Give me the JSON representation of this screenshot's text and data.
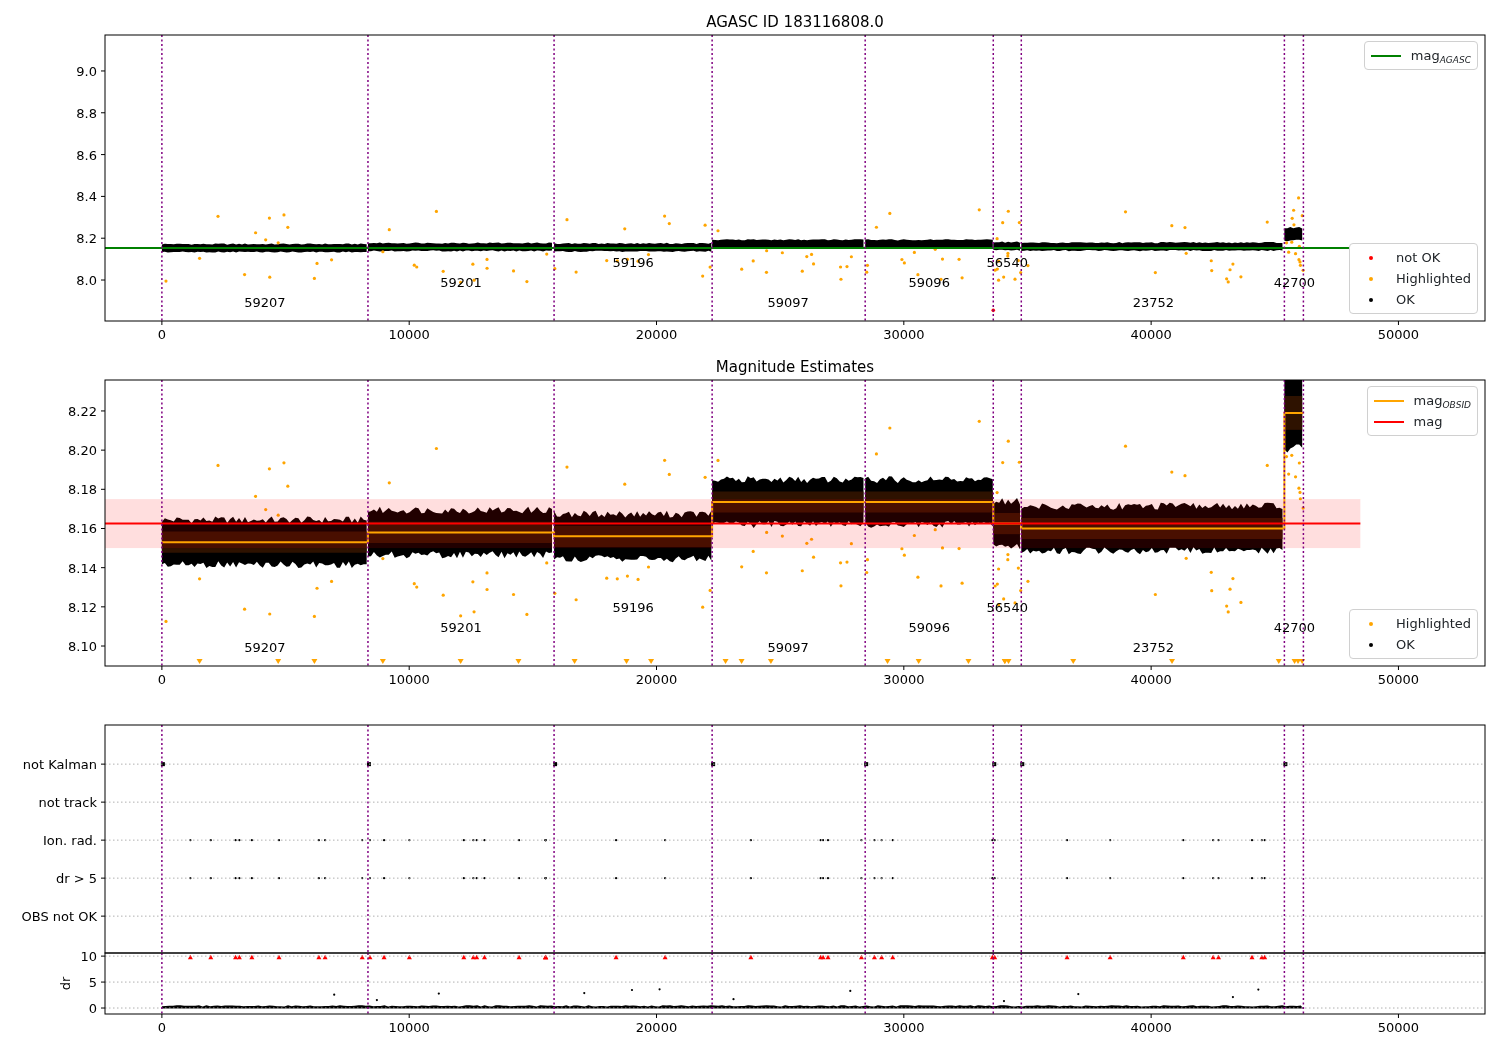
{
  "figure": {
    "charts": [
      {
        "chart_data": {
          "type": "line",
          "title": "AGASC ID 183116808.0",
          "xlim": [
            -2300,
            53500
          ],
          "ylim": [
            7.804,
            9.172
          ],
          "xticks": [
            0,
            10000,
            20000,
            30000,
            40000,
            50000
          ],
          "yticks": [
            {
              "value": 8.0,
              "label": "8.0"
            },
            {
              "value": 8.2,
              "label": "8.2"
            },
            {
              "value": 8.4,
              "label": "8.4"
            },
            {
              "value": 8.6,
              "label": "8.6"
            },
            {
              "value": 8.8,
              "label": "8.8"
            },
            {
              "value": 9.0,
              "label": "9.0"
            }
          ],
          "series": [
            {
              "name": "mag$_{AGASC}$",
              "color": "#008000",
              "x": [
                -2300,
                48000
              ],
              "values": [
                8.153,
                8.153
              ]
            }
          ],
          "ref_lines": [
            {
              "axis": "x",
              "value": 0
            },
            {
              "axis": "x",
              "value": 8333
            },
            {
              "axis": "x",
              "value": 15858
            },
            {
              "axis": "x",
              "value": 22249
            },
            {
              "axis": "x",
              "value": 28438
            },
            {
              "axis": "x",
              "value": 33617
            },
            {
              "axis": "x",
              "value": 34750
            },
            {
              "axis": "x",
              "value": 45388
            },
            {
              "axis": "x",
              "value": 46157
            }
          ],
          "annotations": [
            "59207",
            "59201",
            "59196",
            "59097",
            "59096",
            "56540",
            "23752",
            "42700"
          ]
        },
        "marker_legend": [
          {
            "label": "not OK",
            "color": "#ff0000"
          },
          {
            "label": "Highlighted",
            "color": "#ffa500"
          },
          {
            "label": "OK",
            "color": "#000000"
          }
        ]
      },
      {
        "chart_data": {
          "type": "line",
          "title": "Magnitude Estimates",
          "xlim": [
            -2300,
            53500
          ],
          "ylim": [
            8.0898,
            8.2358
          ],
          "xticks": [
            0,
            10000,
            20000,
            30000,
            40000,
            50000
          ],
          "yticks": [
            {
              "value": 8.1,
              "label": "8.10"
            },
            {
              "value": 8.12,
              "label": "8.12"
            },
            {
              "value": 8.14,
              "label": "8.14"
            },
            {
              "value": 8.16,
              "label": "8.16"
            },
            {
              "value": 8.18,
              "label": "8.18"
            },
            {
              "value": 8.2,
              "label": "8.20"
            },
            {
              "value": 8.22,
              "label": "8.22"
            }
          ],
          "series": [
            {
              "name": "mag$_{OBSID}$",
              "color": "#ffa500",
              "x": [
                0,
                8333,
                8333,
                15858,
                15858,
                22249,
                22249,
                28438,
                28438,
                33617,
                33617,
                34750,
                34750,
                45388,
                45388,
                46157
              ],
              "values": [
                8.153,
                8.153,
                8.158,
                8.158,
                8.156,
                8.156,
                8.1735,
                8.1735,
                8.1735,
                8.1735,
                8.1625,
                8.1625,
                8.16,
                8.16,
                8.219,
                8.219
              ]
            },
            {
              "name": "mag",
              "color": "#ff0000",
              "x": [
                -2300,
                48460
              ],
              "values": [
                8.1625,
                8.1625
              ]
            }
          ],
          "bands": [
            {
              "axis": "y",
              "from": 8.15,
              "to": 8.175,
              "color": "#ff0000"
            }
          ],
          "ref_lines": [
            {
              "axis": "x",
              "value": 0
            },
            {
              "axis": "x",
              "value": 8333
            },
            {
              "axis": "x",
              "value": 15858
            },
            {
              "axis": "x",
              "value": 22249
            },
            {
              "axis": "x",
              "value": 28438
            },
            {
              "axis": "x",
              "value": 33617
            },
            {
              "axis": "x",
              "value": 34750
            },
            {
              "axis": "x",
              "value": 45388
            },
            {
              "axis": "x",
              "value": 46157
            }
          ],
          "annotations": [
            "59207",
            "59201",
            "59196",
            "59097",
            "59096",
            "56540",
            "23752",
            "42700"
          ]
        },
        "marker_legend": [
          {
            "label": "Highlighted",
            "color": "#ffa500"
          },
          {
            "label": "OK",
            "color": "#000000"
          }
        ]
      },
      {
        "chart_data": {
          "type": "scatter",
          "xlim": [
            -2300,
            53500
          ],
          "grid": true,
          "orientation": "horizontal",
          "categories": [
            "not Kalman",
            "not track",
            "Ion. rad.",
            "dr > 5",
            "OBS not OK"
          ],
          "ref_lines": [
            {
              "axis": "x",
              "value": 0
            },
            {
              "axis": "x",
              "value": 8333
            },
            {
              "axis": "x",
              "value": 15858
            },
            {
              "axis": "x",
              "value": 22249
            },
            {
              "axis": "x",
              "value": 28438
            },
            {
              "axis": "x",
              "value": 33617
            },
            {
              "axis": "x",
              "value": 34750
            },
            {
              "axis": "x",
              "value": 45388
            },
            {
              "axis": "x",
              "value": 46157
            }
          ]
        }
      },
      {
        "chart_data": {
          "type": "scatter",
          "ylabel": "dr",
          "xlim": [
            -2300,
            53500
          ],
          "ylim": [
            -1.15,
            10.6
          ],
          "grid": true,
          "xticks": [
            0,
            10000,
            20000,
            30000,
            40000,
            50000
          ],
          "yticks": [
            0,
            5,
            10
          ],
          "ref_lines": [
            {
              "axis": "x",
              "value": 0
            },
            {
              "axis": "x",
              "value": 8333
            },
            {
              "axis": "x",
              "value": 15858
            },
            {
              "axis": "x",
              "value": 22249
            },
            {
              "axis": "x",
              "value": 28438
            },
            {
              "axis": "x",
              "value": 33617
            },
            {
              "axis": "x",
              "value": 34750
            },
            {
              "axis": "x",
              "value": 45388
            },
            {
              "axis": "x",
              "value": 46157
            }
          ]
        }
      }
    ]
  }
}
